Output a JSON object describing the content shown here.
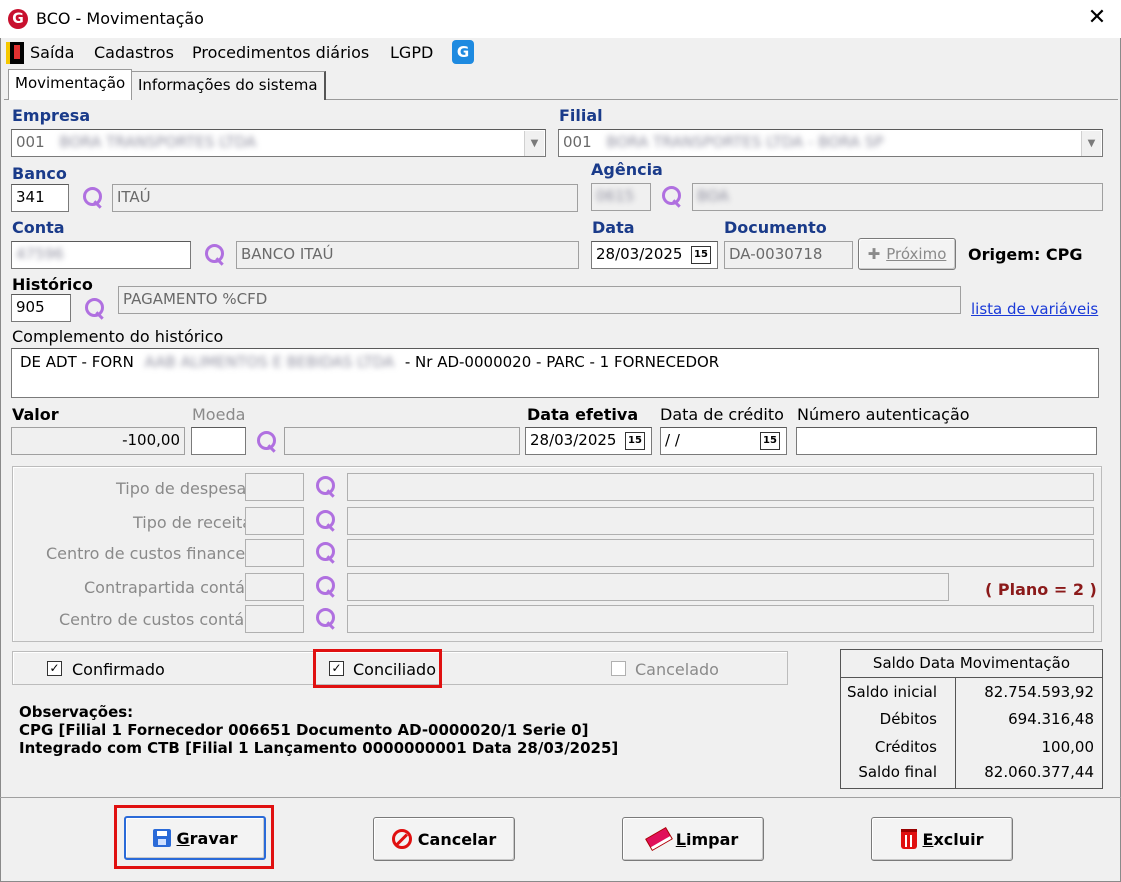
{
  "window": {
    "title": "BCO - Movimentação",
    "close": "✕",
    "app_logo": "G"
  },
  "menu": {
    "items": [
      "Saída",
      "Cadastros",
      "Procedimentos diários",
      "LGPD"
    ],
    "logo": "G"
  },
  "tabs": [
    "Movimentação",
    "Informações do sistema"
  ],
  "empresa": {
    "label": "Empresa",
    "code": "001",
    "name": "BORA TRANSPORTES LTDA"
  },
  "filial": {
    "label": "Filial",
    "code": "001",
    "name": "BORA TRANSPORTES LTDA - BORA SP"
  },
  "banco": {
    "label": "Banco",
    "code": "341",
    "name": "ITAÚ"
  },
  "agencia": {
    "label": "Agência",
    "code": "0615",
    "name": "BOA"
  },
  "conta": {
    "label": "Conta",
    "code": "47596",
    "name": "BANCO ITAÚ"
  },
  "data": {
    "label": "Data",
    "value": "28/03/2025"
  },
  "documento": {
    "label": "Documento",
    "value": "DA-0030718",
    "proximo": "Próximo"
  },
  "origem": "Origem: CPG",
  "historico": {
    "label": "Histórico",
    "code": "905",
    "text": "PAGAMENTO %CFD",
    "link": "lista de variáveis"
  },
  "complemento": {
    "label": "Complemento do histórico",
    "part1": "DE ADT - FORN",
    "blurred": "AAB ALIMENTOS E BEBIDAS LTDA",
    "part2": "- Nr AD-0000020 - PARC - 1   FORNECEDOR"
  },
  "valor": {
    "label": "Valor",
    "value": "-100,00"
  },
  "moeda": {
    "label": "Moeda"
  },
  "data_efetiva": {
    "label": "Data efetiva",
    "value": "28/03/2025"
  },
  "data_credito": {
    "label": "Data de crédito",
    "value": " / /"
  },
  "numero_autenticacao": {
    "label": "Número autenticação"
  },
  "calendar_icon": "15",
  "classificacao": {
    "rows": [
      "Tipo de despesa",
      "Tipo de receita",
      "Centro de custos financeiro",
      "Contrapartida contábil",
      "Centro de custos contábil"
    ],
    "plano": "( Plano = 2 )"
  },
  "checks": {
    "confirmado": {
      "label": "Confirmado",
      "checked": "✓"
    },
    "conciliado": {
      "label": "Conciliado",
      "checked": "✓"
    },
    "cancelado": {
      "label": "Cancelado"
    }
  },
  "observacoes": {
    "title": "Observações:",
    "line1": "CPG [Filial 1 Fornecedor 006651 Documento AD-0000020/1 Serie 0]",
    "line2": "Integrado com CTB [Filial 1 Lançamento 0000000001 Data 28/03/2025]"
  },
  "saldo": {
    "title": "Saldo Data Movimentação",
    "rows": [
      {
        "label": "Saldo inicial",
        "value": "82.754.593,92"
      },
      {
        "label": "Débitos",
        "value": "694.316,48"
      },
      {
        "label": "Créditos",
        "value": "100,00"
      },
      {
        "label": "Saldo final",
        "value": "82.060.377,44"
      }
    ]
  },
  "buttons": {
    "gravar": {
      "first": "G",
      "rest": "ravar"
    },
    "cancelar": "Cancelar",
    "limpar": {
      "first": "L",
      "rest": "impar"
    },
    "excluir": {
      "first": "E",
      "rest": "xcluir"
    }
  },
  "colors": {
    "label_blue": "#1a3b8a",
    "highlight": "#e01010",
    "plano": "#8b1a1a",
    "search_icon": "#b070e0"
  }
}
